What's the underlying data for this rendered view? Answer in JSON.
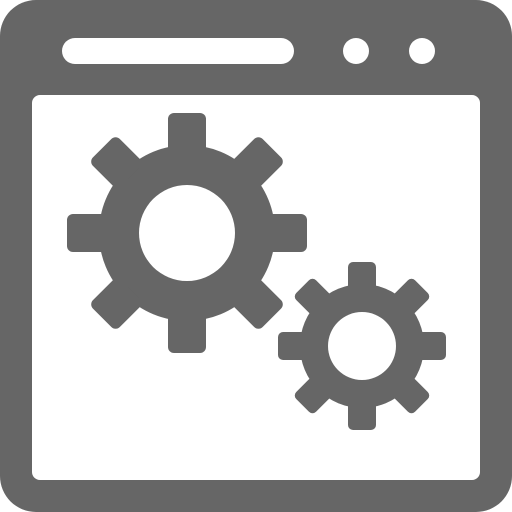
{
  "icon": {
    "name": "browser-settings-icon",
    "color": "#666666",
    "background": "#ffffff"
  }
}
